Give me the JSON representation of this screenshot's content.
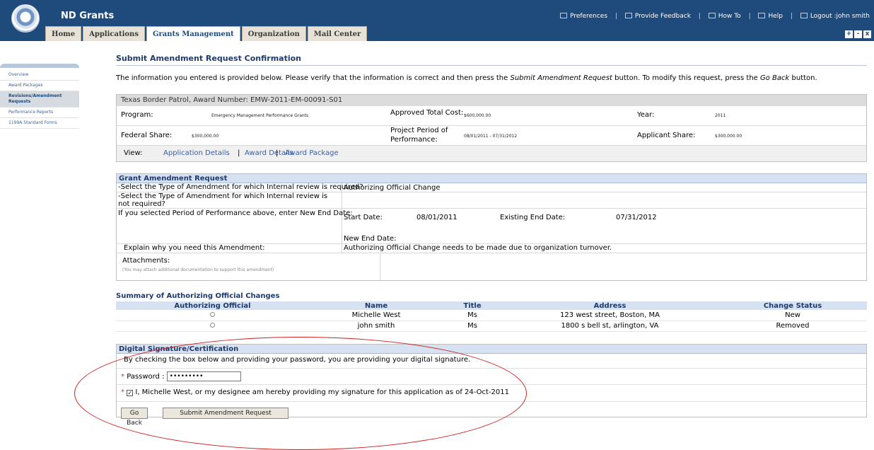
{
  "header": {
    "app_title": "ND Grants",
    "util_links": [
      "Preferences",
      "Provide Feedback",
      "How To",
      "Help",
      "Logout :john smith"
    ],
    "tabs": [
      "Home",
      "Applications",
      "Grants Management",
      "Organization",
      "Mail Center"
    ],
    "active_tab": "Grants Management",
    "window_controls": [
      "+",
      "-",
      "x"
    ]
  },
  "sidebar": {
    "items": [
      "Overview",
      "Award Packages",
      "Revisions/Amendment Requests",
      "Performance Reports",
      "1199A Standard Forms"
    ],
    "active_item": "Revisions/Amendment Requests"
  },
  "page": {
    "title": "Submit Amendment Request Confirmation",
    "intro_1": "The information you entered is provided below. Please verify that the information is correct and then press the ",
    "intro_em1": "Submit Amendment Request",
    "intro_2": " button. To modify this request, press the ",
    "intro_em2": "Go Back",
    "intro_3": " button."
  },
  "award": {
    "header": "Texas Border Patrol, Award Number: EMW-2011-EM-00091-S01",
    "program_label": "Program:",
    "program_value": "Emergency Management Performance Grants",
    "approved_cost_label": "Approved Total Cost:",
    "approved_cost_value": "$600,000.00",
    "year_label": "Year:",
    "year_value": "2011",
    "federal_share_label": "Federal Share:",
    "federal_share_value": "$300,000.00",
    "project_period_label_1": "Project Period of",
    "project_period_label_2": "Performance:",
    "project_period_value": "08/01/2011 - 07/31/2012",
    "applicant_share_label": "Applicant Share:",
    "applicant_share_value": "$300,000.00",
    "view_label": "View:",
    "view_links": [
      "Application Details",
      "Award Details",
      "Award Package"
    ],
    "separator": "|"
  },
  "amendment": {
    "header": "Grant Amendment Request",
    "q1": "-Select the Type of Amendment for which Internal review is required?",
    "a1": "Authorizing Official Change",
    "q2": "-Select the Type of Amendment for which Internal review is not required?",
    "q3": "If you selected Period of Performance above, enter New End Date:",
    "start_date_label": "Start Date:",
    "start_date_value": "08/01/2011",
    "existing_end_label": "Existing End Date:",
    "existing_end_value": "07/31/2012",
    "new_end_label": "New End Date:",
    "q4": "Explain why you need this Amendment:",
    "a4": "Authorizing Official Change needs to be made due to organization turnover.",
    "attachments_label": "Attachments:",
    "attachments_hint": "(You may attach additional documentation to support this amendment)"
  },
  "summary": {
    "title": "Summary of Authorizing Official Changes",
    "columns": [
      "Authorizing Official",
      "Name",
      "Title",
      "Address",
      "Change Status"
    ],
    "rows": [
      {
        "name": "Michelle West",
        "title": "Ms",
        "address": "123 west street, Boston, MA",
        "status": "New"
      },
      {
        "name": "john smith",
        "title": "Ms",
        "address": "1800 s bell st, arlington, VA",
        "status": "Removed"
      }
    ]
  },
  "signature": {
    "header": "Digital Signature/Certification",
    "notice": "By checking the box below and providing your password, you are providing your digital signature.",
    "required_mark": "*",
    "password_label": "Password :",
    "password_value": "•••••••••",
    "certify_checked": true,
    "certify_mark": "✓",
    "certify_text": "I, Michelle West, or my designee am hereby providing my signature for this application as of 24-Oct-2011"
  },
  "buttons": {
    "go_back": "Go Back",
    "submit": "Submit Amendment Request"
  },
  "colors": {
    "header_bg": "#1f4a7c",
    "panel_head_bg": "#d6e2f1",
    "annotation": "#cc2222"
  }
}
